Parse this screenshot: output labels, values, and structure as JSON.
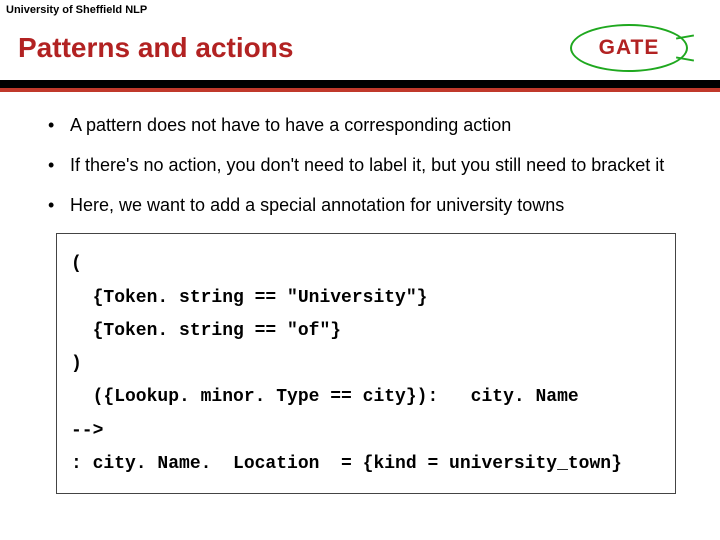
{
  "header": {
    "strip": "University of Sheffield NLP",
    "title": "Patterns and actions",
    "logo_text": "GATE"
  },
  "bullets": [
    "A pattern does not have to have a corresponding action",
    "If there's no action, you don't need to label it, but you still need to bracket it",
    "Here, we want to add a special annotation for university towns"
  ],
  "codebox": "(\n  {Token. string == \"University\"}\n  {Token. string == \"of\"}\n)\n  ({Lookup. minor. Type == city}):   city. Name\n-->\n: city. Name.  Location  = {kind = university_town}"
}
